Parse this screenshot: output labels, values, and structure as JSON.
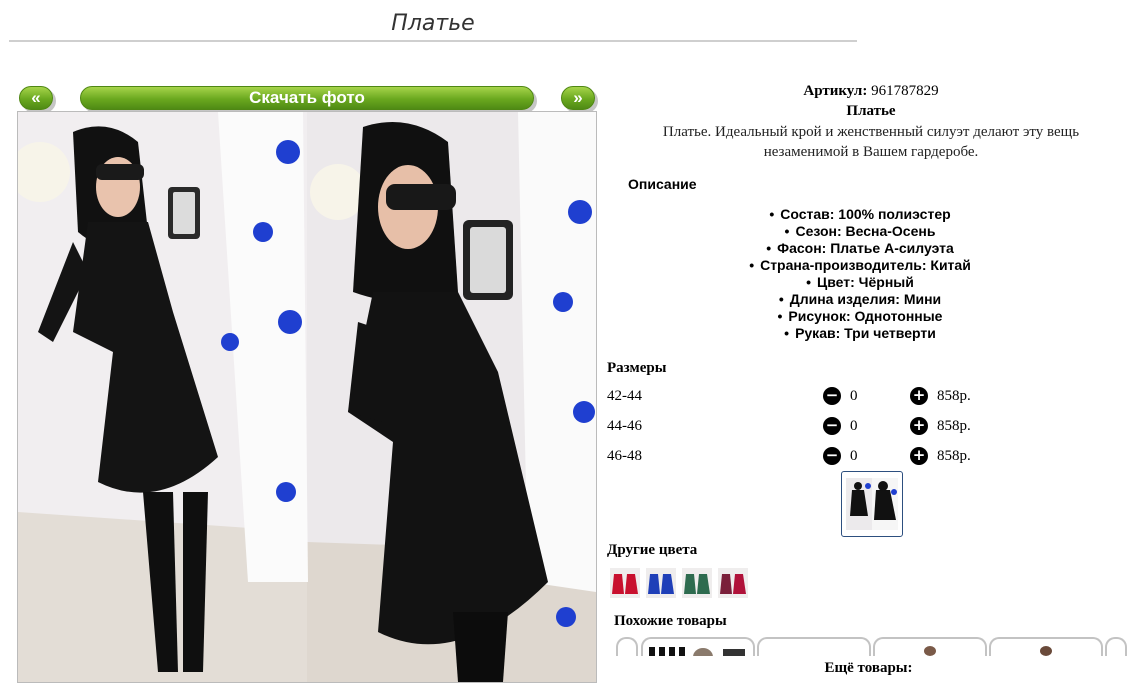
{
  "page": {
    "title": "Платье"
  },
  "gallery": {
    "prev_label": "«",
    "next_label": "»",
    "download_label": "Скачать фото"
  },
  "product": {
    "sku_label": "Артикул:",
    "sku_value": "961787829",
    "name": "Платье",
    "description": "Платье. Идеальный крой и женственный силуэт делают эту вещь незаменимой в Вашем гардеробе.",
    "description_heading": "Описание",
    "properties": [
      "Состав: 100% полиэстер",
      "Сезон: Весна-Осень",
      "Фасон: Платье А-силуэта",
      "Страна-производитель: Китай",
      "Цвет: Чёрный",
      "Длина изделия: Мини",
      "Рисунок: Однотонные",
      "Рукав: Три четверти"
    ]
  },
  "sizes": {
    "heading": "Размеры",
    "rows": [
      {
        "size": "42-44",
        "qty": "0",
        "price": "858р."
      },
      {
        "size": "44-46",
        "qty": "0",
        "price": "858р."
      },
      {
        "size": "46-48",
        "qty": "0",
        "price": "858р."
      }
    ]
  },
  "other_colors": {
    "heading": "Другие цвета",
    "swatches": [
      "#c8102e",
      "#1f3fb8",
      "#2e6b4f",
      "#7a1f3a",
      "#b0123a"
    ]
  },
  "similar": {
    "heading": "Похожие товары"
  },
  "more": {
    "label": "Ещё товары:"
  },
  "icons": {
    "minus": "minus-circle-icon",
    "plus": "plus-circle-icon"
  },
  "colors": {
    "accent_green": "#6aa81f",
    "dress": "#111111",
    "ornament_blue": "#1f3fd0"
  }
}
